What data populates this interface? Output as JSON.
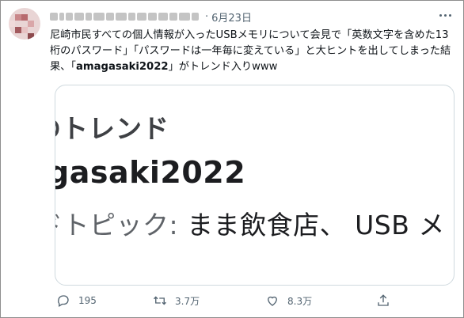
{
  "tweet": {
    "date": "6月23日",
    "separator": "·",
    "text_part1": "尼崎市民すべての個人情報が入ったUSBメモリについて会見で「英数文字を含めた13桁のパスワード」「パスワードは一年毎に変えている」と大ヒントを出してしまった結果、「",
    "text_bold": "amagasaki2022",
    "text_part2": "」がトレンド入りwww"
  },
  "card": {
    "line1": "のトレンド",
    "line2": "gasaki2022",
    "line3_prefix": "ドトピック: ",
    "line3_main": "まま飲食店、 USB メ"
  },
  "actions": {
    "reply_count": "195",
    "retweet_count": "3.7万",
    "like_count": "8.3万"
  },
  "colors": {
    "text": "#0f1419",
    "secondary": "#536471",
    "border": "#cfd9de"
  },
  "icons": [
    "reply-icon",
    "retweet-icon",
    "like-icon",
    "share-icon",
    "more-icon"
  ]
}
